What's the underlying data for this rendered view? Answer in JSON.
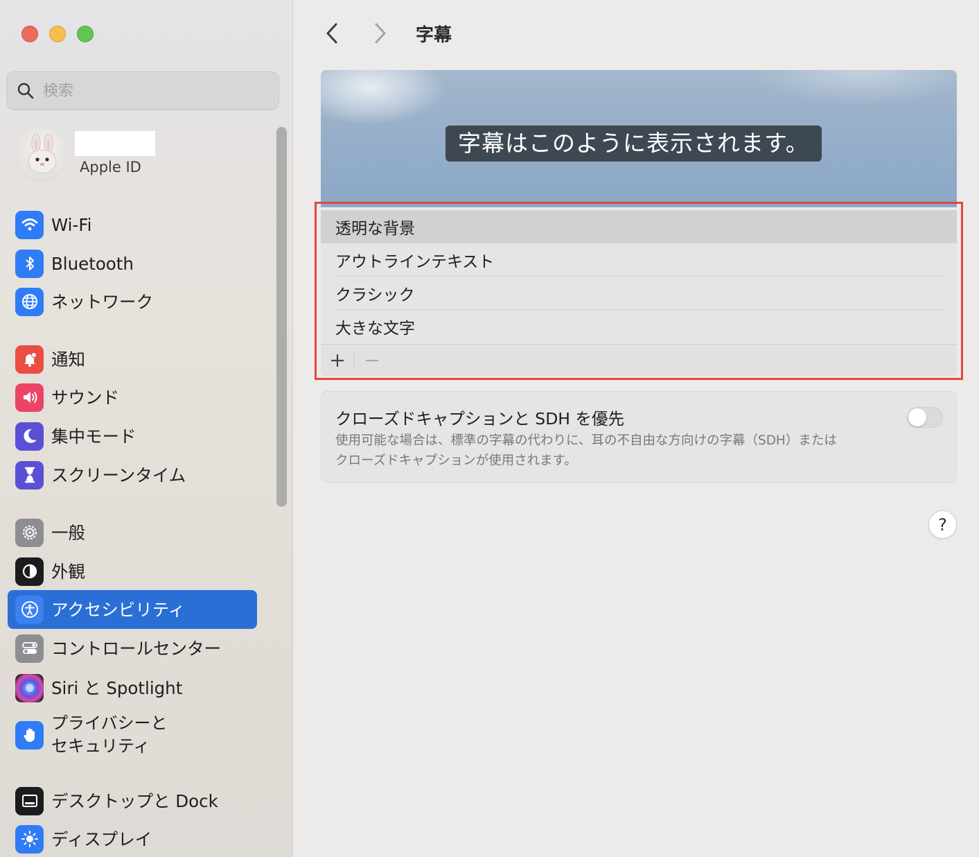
{
  "sidebar": {
    "search": {
      "placeholder": "検索"
    },
    "account": {
      "subtitle": "Apple ID"
    },
    "items": [
      {
        "id": "wifi",
        "label": "Wi-Fi",
        "icon": "wifi-icon",
        "color": "#2f7cf6"
      },
      {
        "id": "bluetooth",
        "label": "Bluetooth",
        "icon": "bluetooth-icon",
        "color": "#2f7cf6"
      },
      {
        "id": "network",
        "label": "ネットワーク",
        "icon": "globe-icon",
        "color": "#2f7cf6"
      },
      {
        "id": "notifications",
        "label": "通知",
        "icon": "bell-icon",
        "color": "#eb4d42"
      },
      {
        "id": "sound",
        "label": "サウンド",
        "icon": "speaker-icon",
        "color": "#ec4466"
      },
      {
        "id": "focus",
        "label": "集中モード",
        "icon": "moon-icon",
        "color": "#5b4fd6"
      },
      {
        "id": "screentime",
        "label": "スクリーンタイム",
        "icon": "hourglass-icon",
        "color": "#5b4fd6"
      },
      {
        "id": "general",
        "label": "一般",
        "icon": "gear-icon",
        "color": "#8e8e92"
      },
      {
        "id": "appearance",
        "label": "外観",
        "icon": "appearance-icon",
        "color": "#1c1c1e"
      },
      {
        "id": "accessibility",
        "label": "アクセシビリティ",
        "icon": "accessibility-icon",
        "color": "#2a6fd6",
        "active": true
      },
      {
        "id": "controlcenter",
        "label": "コントロールセンター",
        "icon": "toggles-icon",
        "color": "#8e8e92"
      },
      {
        "id": "siri",
        "label": "Siri と Spotlight",
        "icon": "siri-icon",
        "color": "#2b2b40"
      },
      {
        "id": "privacy",
        "label": "プライバシーと\nセキュリティ",
        "icon": "hand-icon",
        "color": "#2f7cf6"
      },
      {
        "id": "desktop",
        "label": "デスクトップと Dock",
        "icon": "dock-icon",
        "color": "#1c1c1e"
      },
      {
        "id": "displays",
        "label": "ディスプレイ",
        "icon": "sun-icon",
        "color": "#2f7cf6"
      }
    ]
  },
  "header": {
    "title": "字幕"
  },
  "preview": {
    "sample_text": "字幕はこのように表示されます。"
  },
  "styles": {
    "items": [
      {
        "label": "透明な背景",
        "selected": true
      },
      {
        "label": "アウトラインテキスト",
        "selected": false
      },
      {
        "label": "クラシック",
        "selected": false
      },
      {
        "label": "大きな文字",
        "selected": false
      }
    ],
    "add_label": "+",
    "remove_label": "−"
  },
  "sdh": {
    "title": "クローズドキャプションと SDH を優先",
    "description": "使用可能な場合は、標準の字幕の代わりに、耳の不自由な方向けの字幕（SDH）または\nクローズドキャプションが使用されます。",
    "enabled": false
  },
  "help": {
    "label": "?"
  },
  "colors": {
    "accent": "#2a6fd6",
    "highlight_border": "#e0483b"
  }
}
